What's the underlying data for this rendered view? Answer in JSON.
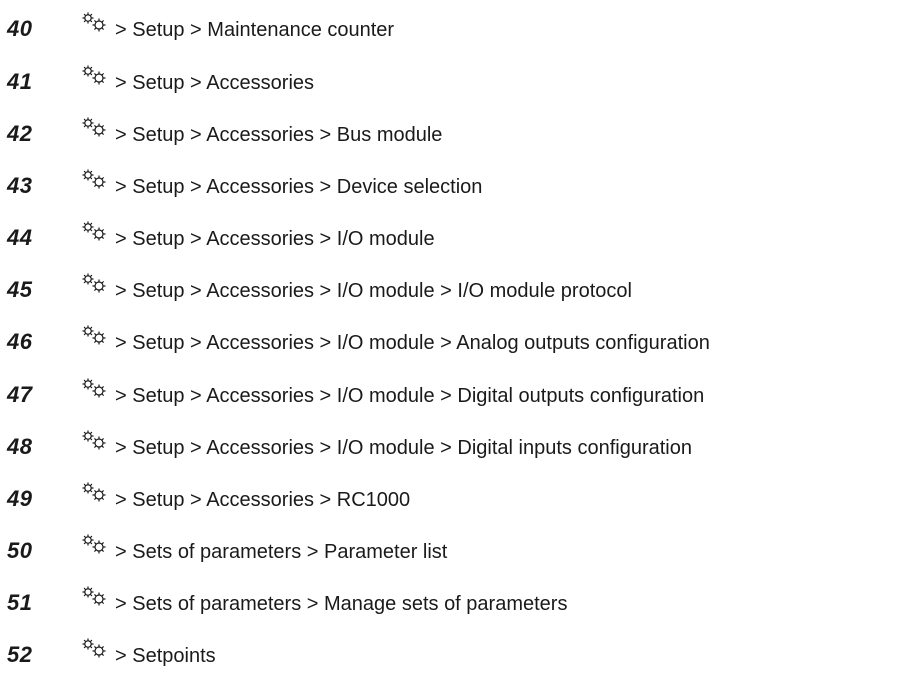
{
  "entries": [
    {
      "number": "40",
      "icon": "gears-icon",
      "path": "> Setup > Maintenance counter"
    },
    {
      "number": "41",
      "icon": "gears-icon",
      "path": "> Setup > Accessories"
    },
    {
      "number": "42",
      "icon": "gears-icon",
      "path": "> Setup > Accessories > Bus module"
    },
    {
      "number": "43",
      "icon": "gears-icon",
      "path": "> Setup > Accessories > Device selection"
    },
    {
      "number": "44",
      "icon": "gears-icon",
      "path": "> Setup > Accessories > I/O module"
    },
    {
      "number": "45",
      "icon": "gears-icon",
      "path": "> Setup > Accessories > I/O module > I/O module protocol"
    },
    {
      "number": "46",
      "icon": "gears-icon",
      "path": "> Setup > Accessories > I/O module > Analog outputs configuration"
    },
    {
      "number": "47",
      "icon": "gears-icon",
      "path": "> Setup > Accessories > I/O module > Digital outputs configuration"
    },
    {
      "number": "48",
      "icon": "gears-icon",
      "path": "> Setup > Accessories > I/O module > Digital inputs configuration"
    },
    {
      "number": "49",
      "icon": "gears-icon",
      "path": "> Setup > Accessories > RC1000"
    },
    {
      "number": "50",
      "icon": "gears-icon",
      "path": "> Sets of parameters > Parameter list"
    },
    {
      "number": "51",
      "icon": "gears-icon",
      "path": "> Sets of parameters > Manage sets of parameters"
    },
    {
      "number": "52",
      "icon": "gears-icon",
      "path": "> Setpoints"
    }
  ]
}
